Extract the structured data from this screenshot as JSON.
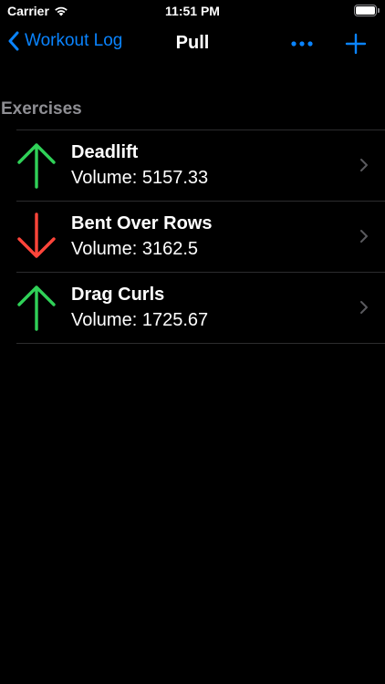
{
  "status_bar": {
    "carrier": "Carrier",
    "time": "11:51 PM"
  },
  "nav": {
    "back_label": "Workout Log",
    "title": "Pull"
  },
  "section": {
    "header": "Exercises"
  },
  "exercises": [
    {
      "name": "Deadlift",
      "volume_text": "Volume: 5157.33",
      "trend": "up"
    },
    {
      "name": "Bent Over Rows",
      "volume_text": "Volume: 3162.5",
      "trend": "down"
    },
    {
      "name": "Drag Curls",
      "volume_text": "Volume: 1725.67",
      "trend": "up"
    }
  ],
  "colors": {
    "accent": "#0a84ff",
    "trend_up": "#30d158",
    "trend_down": "#ff453a",
    "secondary_text": "#8e8e93",
    "separator": "#2c2c2e"
  },
  "icons": {
    "back": "chevron-left-icon",
    "more": "ellipsis-icon",
    "add": "plus-icon",
    "up": "arrow-up-icon",
    "down": "arrow-down-icon",
    "disclosure": "chevron-right-icon"
  }
}
